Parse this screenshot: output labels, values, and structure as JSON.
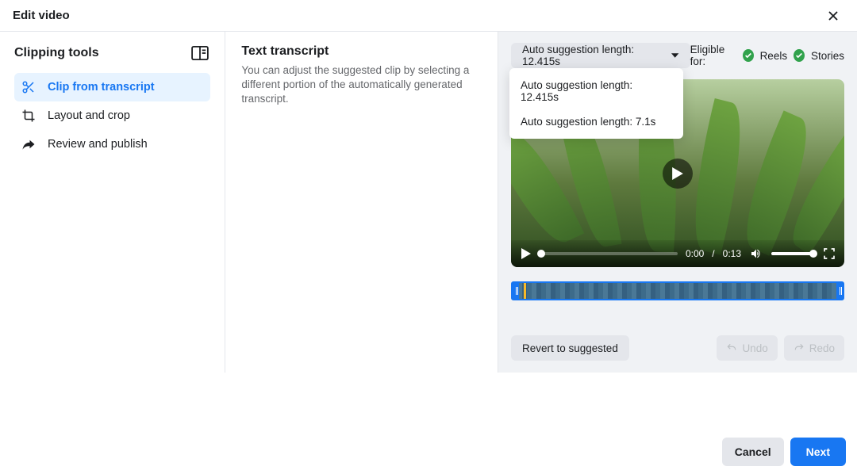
{
  "header": {
    "title": "Edit video"
  },
  "sidebar": {
    "title": "Clipping tools",
    "items": [
      {
        "label": "Clip from transcript"
      },
      {
        "label": "Layout and crop"
      },
      {
        "label": "Review and publish"
      }
    ]
  },
  "transcript": {
    "title": "Text transcript",
    "desc": "You can adjust the suggested clip by selecting a different portion of the automatically generated transcript."
  },
  "dropdown": {
    "selected": "Auto suggestion length: 12.415s",
    "options": [
      "Auto suggestion length: 12.415s",
      "Auto suggestion length: 7.1s"
    ]
  },
  "eligibility": {
    "label": "Eligible for:",
    "reels": "Reels",
    "stories": "Stories"
  },
  "player": {
    "current": "0:00",
    "separator": " / ",
    "duration": "0:13"
  },
  "actions": {
    "revert": "Revert to suggested",
    "undo": "Undo",
    "redo": "Redo"
  },
  "footer": {
    "cancel": "Cancel",
    "next": "Next"
  }
}
